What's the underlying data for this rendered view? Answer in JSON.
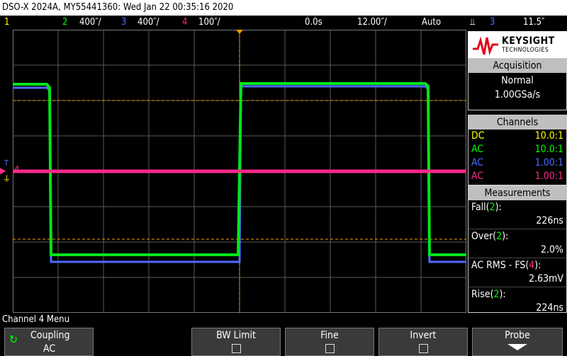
{
  "title_bar": "DSO-X 2024A, MY55441360: Wed Jan 22 00:35:16 2020",
  "status": {
    "ch1_num": "1",
    "ch2_num": "2",
    "ch2_scale": "400″/",
    "ch3_num": "3",
    "ch3_scale": "400″/",
    "ch4_num": "4",
    "ch4_scale": "100″/",
    "delay": "0.0s",
    "timebase": "12.00″/",
    "trigger_mode": "Auto",
    "trigger_source": "3",
    "trigger_level": "11.5″"
  },
  "channel_colors": {
    "ch1": "#ffff00",
    "ch2": "#00ff00",
    "ch3": "#4f6bff",
    "ch4": "#ff2a8a",
    "trigger": "#ff9c00"
  },
  "logo": {
    "brand": "KEYSIGHT",
    "sub": "TECHNOLOGIES"
  },
  "acquisition": {
    "header": "Acquisition",
    "mode": "Normal",
    "rate": "1.00GSa/s"
  },
  "channels": {
    "header": "Channels",
    "rows": [
      {
        "coupling": "DC",
        "probe": "10.0:1"
      },
      {
        "coupling": "AC",
        "probe": "10.0:1"
      },
      {
        "coupling": "AC",
        "probe": "1.00:1"
      },
      {
        "coupling": "AC",
        "probe": "1.00:1"
      }
    ]
  },
  "measurements": {
    "header": "Measurements",
    "items": [
      {
        "name": "Fall(",
        "ch": "2",
        "close": "):",
        "value": "226ns"
      },
      {
        "name": "Over(",
        "ch": "2",
        "close": "):",
        "value": "2.0%"
      },
      {
        "name": "AC RMS - FS(",
        "ch": "4",
        "close": "):",
        "value": "2.63mV"
      },
      {
        "name": "Rise(",
        "ch": "2",
        "close": "):",
        "value": "224ns"
      }
    ]
  },
  "ground_markers": {
    "t_label": "T",
    "ch4_label": "4"
  },
  "menu": {
    "title": "Channel 4 Menu",
    "softkeys": [
      {
        "label": "Coupling",
        "value": "AC"
      },
      {
        "label": "BW Limit"
      },
      {
        "label": "Fine"
      },
      {
        "label": "Invert"
      },
      {
        "label": "Probe"
      }
    ]
  }
}
